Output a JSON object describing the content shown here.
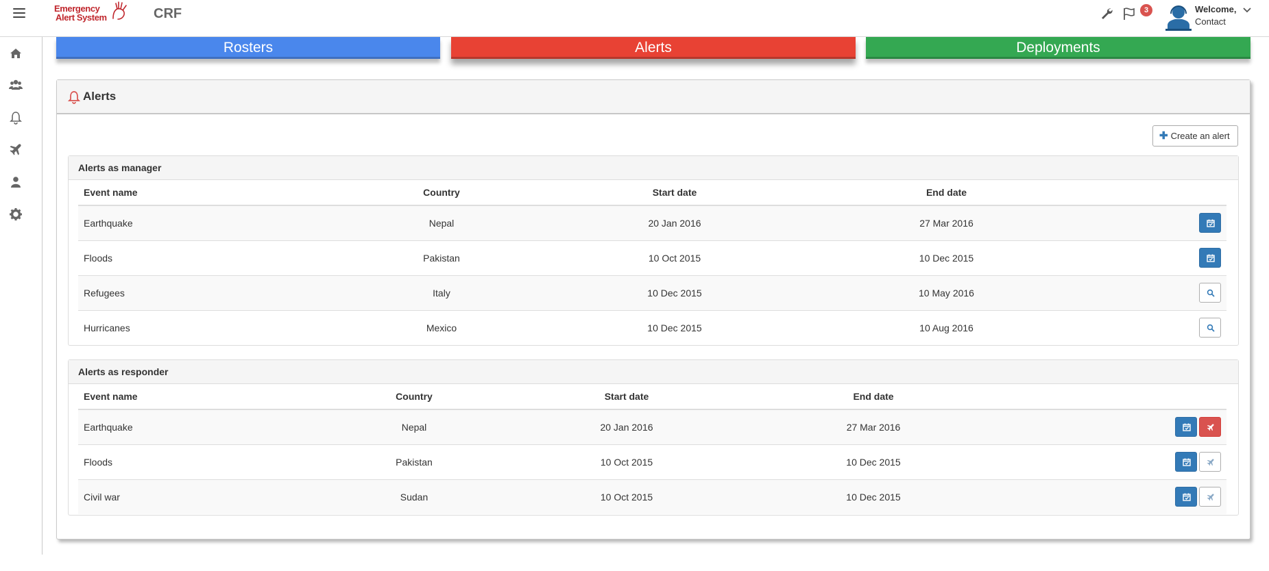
{
  "app": {
    "logo_line1": "Emergency",
    "logo_line2": "Alert System",
    "org": "CRF"
  },
  "header": {
    "flag_count": "3",
    "welcome": "Welcome,",
    "user": "Contact"
  },
  "sidebar": [
    "home-icon",
    "users-icon",
    "bell-icon",
    "plane-icon",
    "user-icon",
    "gear-icon"
  ],
  "tabs": {
    "rosters": "Rosters",
    "alerts": "Alerts",
    "deployments": "Deployments"
  },
  "panel": {
    "title": "Alerts",
    "create_button": "Create an alert"
  },
  "manager": {
    "title": "Alerts as manager",
    "headers": [
      "Event name",
      "Country",
      "Start date",
      "End date"
    ],
    "rows": [
      {
        "event": "Earthquake",
        "country": "Nepal",
        "start": "20 Jan 2016",
        "end": "27 Mar 2016",
        "action": "calendar"
      },
      {
        "event": "Floods",
        "country": "Pakistan",
        "start": "10 Oct 2015",
        "end": "10 Dec 2015",
        "action": "calendar"
      },
      {
        "event": "Refugees",
        "country": "Italy",
        "start": "10 Dec 2015",
        "end": "10 May 2016",
        "action": "search"
      },
      {
        "event": "Hurricanes",
        "country": "Mexico",
        "start": "10 Dec 2015",
        "end": "10 Aug 2016",
        "action": "search"
      }
    ]
  },
  "responder": {
    "title": "Alerts as responder",
    "headers": [
      "Event name",
      "Country",
      "Start date",
      "End date"
    ],
    "rows": [
      {
        "event": "Earthquake",
        "country": "Nepal",
        "start": "20 Jan 2016",
        "end": "27 Mar 2016",
        "deploy_active": true
      },
      {
        "event": "Floods",
        "country": "Pakistan",
        "start": "10 Oct 2015",
        "end": "10 Dec 2015",
        "deploy_active": false
      },
      {
        "event": "Civil war",
        "country": "Sudan",
        "start": "10 Oct 2015",
        "end": "10 Dec 2015",
        "deploy_active": false
      }
    ]
  },
  "colors": {
    "rosters": "#4a87ec",
    "alerts": "#e84234",
    "deployments": "#34a852",
    "primary": "#337ab7",
    "danger": "#d9534f"
  }
}
